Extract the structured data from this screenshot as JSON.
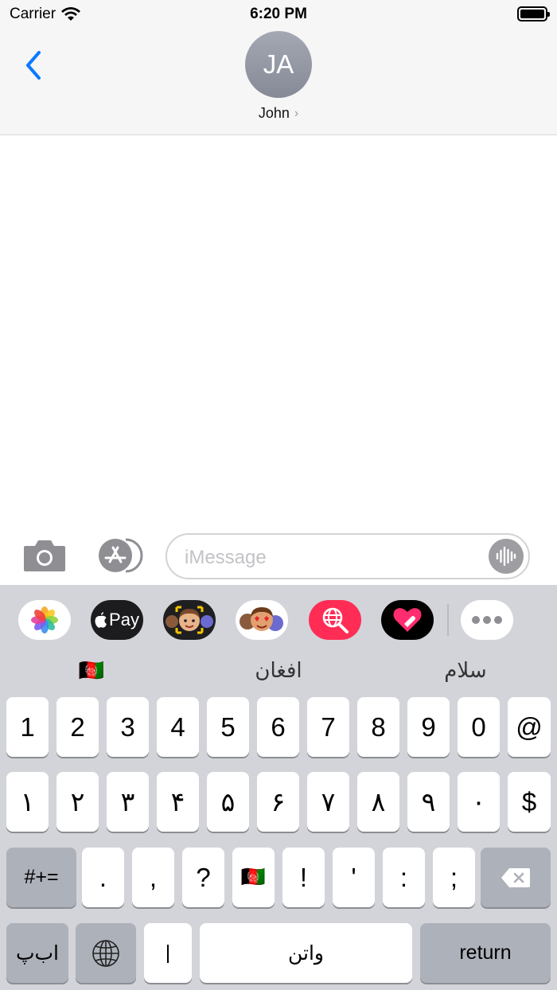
{
  "status_bar": {
    "carrier": "Carrier",
    "time": "6:20 PM"
  },
  "header": {
    "avatar_initials": "JA",
    "contact_name": "John",
    "chevron": "›"
  },
  "compose": {
    "placeholder": "iMessage"
  },
  "app_drawer": {
    "apple_pay_label": "Pay",
    "icons": [
      "photos-icon",
      "apple-pay-icon",
      "memoji-icon",
      "animoji-icon",
      "web-search-icon",
      "digital-touch-icon",
      "more-icon"
    ]
  },
  "keyboard": {
    "suggestions": [
      "🇦🇫",
      "افغان",
      "سلام"
    ],
    "row1": [
      "1",
      "2",
      "3",
      "4",
      "5",
      "6",
      "7",
      "8",
      "9",
      "0",
      "@"
    ],
    "row2": [
      "۱",
      "۲",
      "۳",
      "۴",
      "۵",
      "۶",
      "۷",
      "۸",
      "۹",
      "۰",
      "$"
    ],
    "row3": [
      "#+=",
      ".",
      ",",
      "?",
      "🇦🇫",
      "!",
      "'",
      ":",
      ";"
    ],
    "row4": {
      "lang_key": "اب‌پ",
      "zwnj_key": "|",
      "space_key": "واتن",
      "return_key": "return"
    }
  },
  "colors": {
    "accent": "#0a7aff",
    "keyboard_bg": "#d2d4d9",
    "header_bg": "#f6f6f6"
  }
}
